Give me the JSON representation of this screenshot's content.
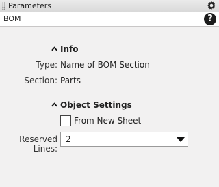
{
  "window": {
    "title": "Parameters"
  },
  "subheader": {
    "title": "BOM",
    "help_glyph": "?"
  },
  "info": {
    "header": "Info",
    "type_label": "Type:",
    "type_value": "Name of BOM Section",
    "section_label": "Section:",
    "section_value": "Parts"
  },
  "object_settings": {
    "header": "Object Settings",
    "from_new_sheet_label": "From New Sheet",
    "from_new_sheet_checked": false,
    "reserved_lines_label": "Reserved Lines:",
    "reserved_lines_value": "2"
  },
  "icons": {
    "gear": "gear-icon",
    "help": "help-icon",
    "collapse": "chevron-up-icon",
    "dropdown": "caret-down-icon",
    "grip": "grip-icon"
  }
}
